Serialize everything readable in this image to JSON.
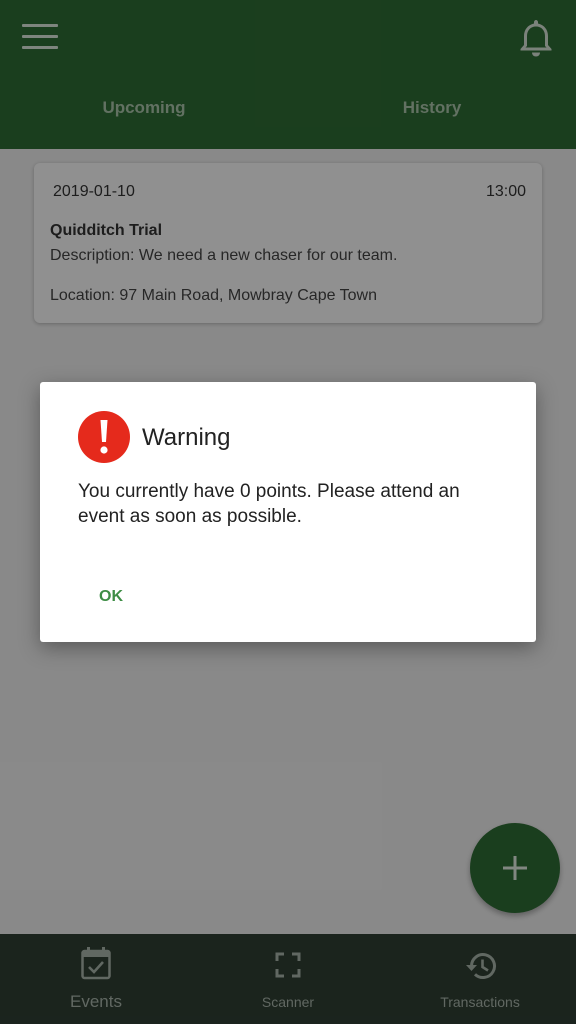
{
  "colors": {
    "primary": "#2e6b34",
    "bottom_nav": "#2f3e33",
    "warning_red": "#e52a1c",
    "ok_text": "#3e8d45"
  },
  "header": {
    "menu_icon": "hamburger-menu-icon",
    "notification_icon": "bell-icon",
    "tabs": [
      {
        "label": "Upcoming"
      },
      {
        "label": "History"
      }
    ]
  },
  "event_card": {
    "date": "2019-01-10",
    "time": "13:00",
    "title": "Quidditch Trial",
    "description": "Description: We need a new chaser for our team.",
    "location": "Location: 97 Main Road, Mowbray Cape Town"
  },
  "fab": {
    "icon": "plus-icon"
  },
  "bottom_nav": {
    "items": [
      {
        "label": "Events",
        "icon": "calendar-check-icon"
      },
      {
        "label": "Scanner",
        "icon": "scan-frame-icon"
      },
      {
        "label": "Transactions",
        "icon": "history-icon"
      }
    ]
  },
  "dialog": {
    "icon": "warning-exclamation-icon",
    "title": "Warning",
    "message": "You currently have 0 points. Please attend an event as soon as possible.",
    "ok_label": "OK"
  }
}
